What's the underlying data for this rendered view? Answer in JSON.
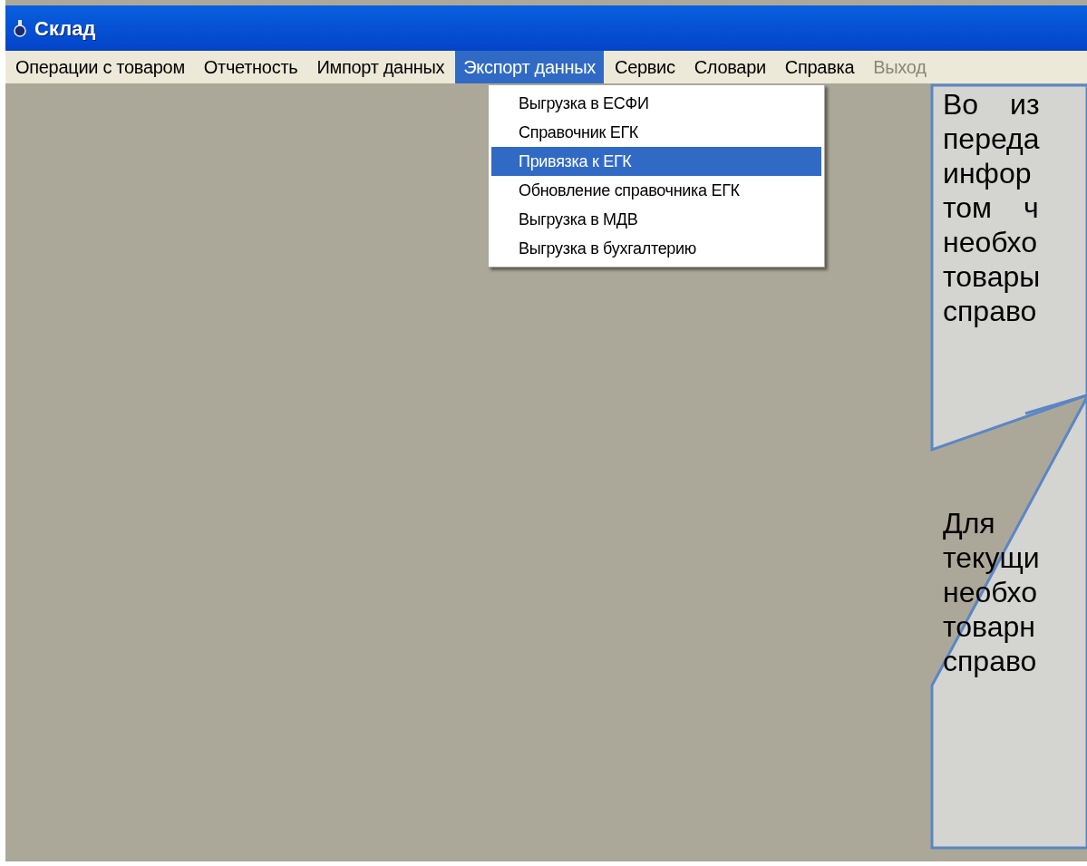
{
  "window": {
    "title": "Склад"
  },
  "menu": [
    {
      "label": "Операции с товаром",
      "selected": false,
      "disabled": false
    },
    {
      "label": "Отчетность",
      "selected": false,
      "disabled": false
    },
    {
      "label": "Импорт данных",
      "selected": false,
      "disabled": false
    },
    {
      "label": "Экспорт данных",
      "selected": true,
      "disabled": false
    },
    {
      "label": "Сервис",
      "selected": false,
      "disabled": false
    },
    {
      "label": "Словари",
      "selected": false,
      "disabled": false
    },
    {
      "label": "Справка",
      "selected": false,
      "disabled": false
    },
    {
      "label": "Выход",
      "selected": false,
      "disabled": true
    }
  ],
  "dropdown": [
    {
      "label": "Выгрузка в ЕСФИ",
      "selected": false
    },
    {
      "label": "Справочник ЕГК",
      "selected": false
    },
    {
      "label": "Привязка к ЕГК",
      "selected": true
    },
    {
      "label": "Обновление справочника ЕГК",
      "selected": false
    },
    {
      "label": "Выгрузка в МДВ",
      "selected": false
    },
    {
      "label": "Выгрузка в бухгалтерию",
      "selected": false
    }
  ],
  "callouts": [
    {
      "lines": [
        "Во из",
        "переда",
        "инфор",
        "том ч",
        "необхо",
        "товары",
        "справо"
      ]
    },
    {
      "lines": [
        "Для",
        "текущи",
        "необхо",
        "товарн",
        "справо"
      ]
    }
  ]
}
